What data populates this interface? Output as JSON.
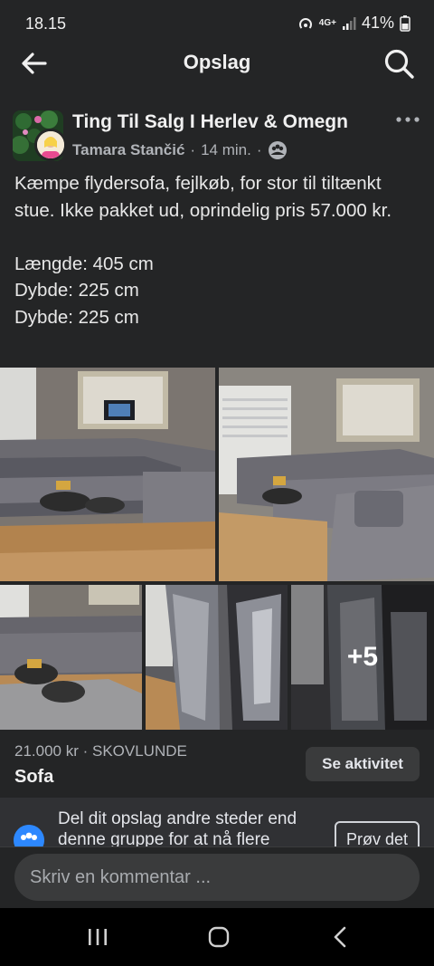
{
  "status": {
    "time": "18.15",
    "network": "4G+",
    "battery": "41%"
  },
  "app_bar": {
    "title": "Opslag"
  },
  "post": {
    "group_name": "Ting Til Salg I Herlev & Omegn",
    "author": "Tamara Stančić",
    "time": "14 min.",
    "separator": "·",
    "text": "Kæmpe flydersofa, fejlkøb, for stor til tiltænkt stue. Ikke pakket ud, oprindelig pris 57.000 kr.\n\nLængde: 405 cm\nDybde: 225 cm\nDybde: 225 cm",
    "more_photos": "+5"
  },
  "listing": {
    "price_location": "21.000 kr · SKOVLUNDE",
    "title": "Sofa",
    "activity_button": "Se aktivitet"
  },
  "share_banner": {
    "text": "Del dit opslag andre steder end denne gruppe for at nå flere",
    "button": "Prøv det"
  },
  "comment": {
    "placeholder": "Skriv en kommentar ..."
  },
  "colors": {
    "background": "#242526",
    "surface": "#3a3b3c",
    "accent": "#2d88ff"
  }
}
